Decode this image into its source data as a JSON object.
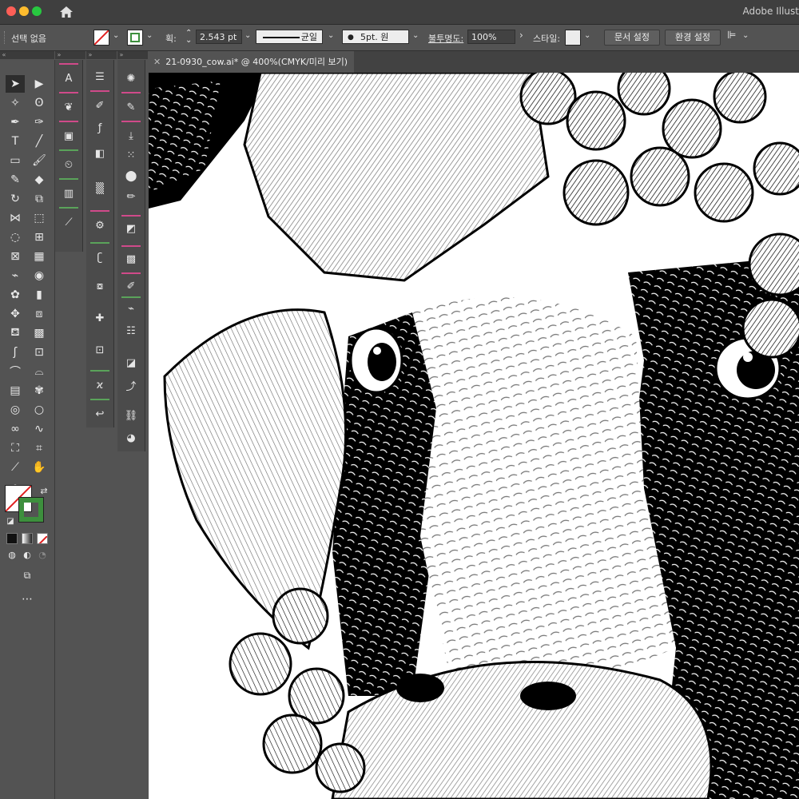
{
  "app": {
    "title": "Adobe Illust"
  },
  "control_bar": {
    "selection": "선택 없음",
    "stroke_label": "획:",
    "stroke_value": "2.543 pt",
    "profile_label": "균일",
    "brush_label": "5pt. 원",
    "opacity_label": "불투명도:",
    "opacity_value": "100%",
    "style_label": "스타일:",
    "doc_setup": "문서 설정",
    "preferences": "환경 설정"
  },
  "document": {
    "tab_title": "21-0930_cow.ai* @ 400%(CMYK/미리 보기)"
  },
  "colors": {
    "fill": "none",
    "stroke": "#3d8f3d",
    "accent_pink": "#d04a8a",
    "accent_green": "#5aa35a"
  }
}
